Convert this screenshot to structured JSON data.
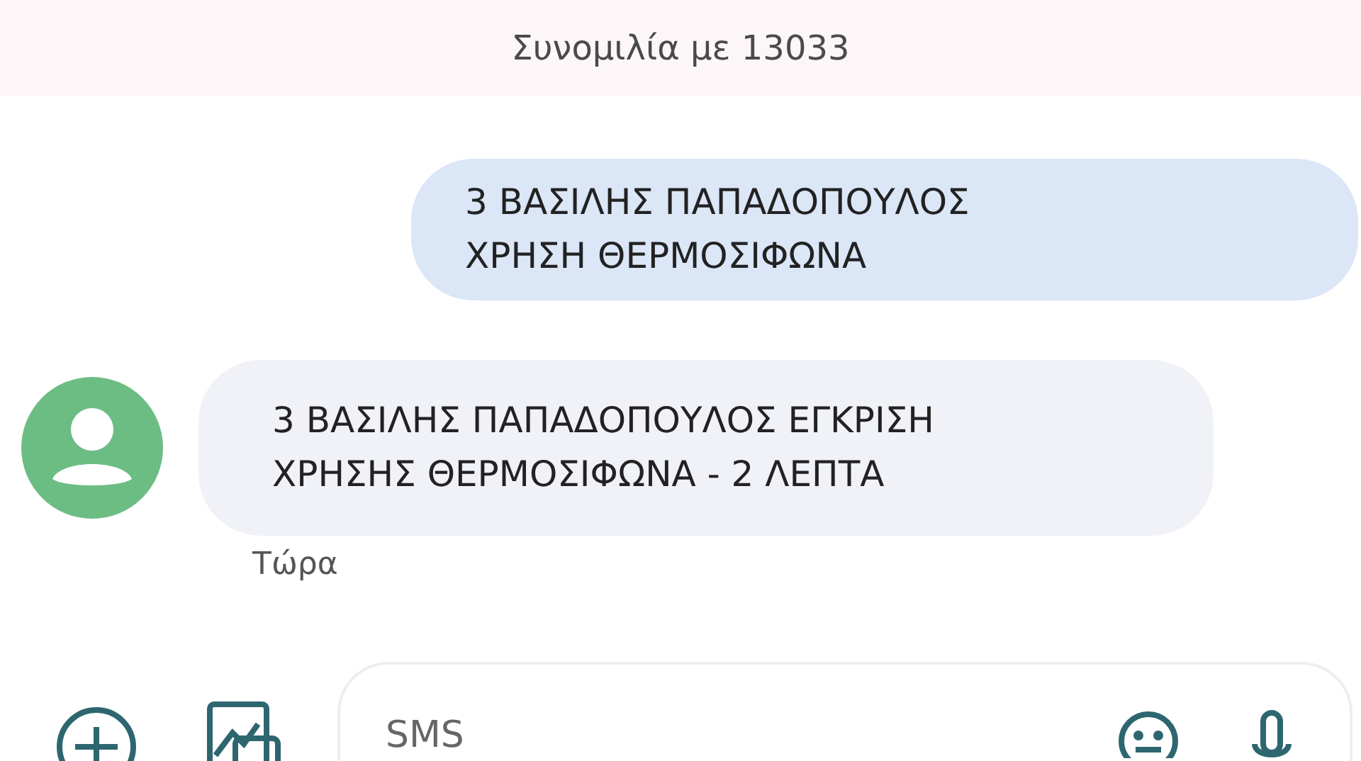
{
  "header": {
    "title": "Συνομιλία με 13033"
  },
  "messages": [
    {
      "kind": "sent",
      "text": "3 ΒΑΣΙΛΗΣ ΠΑΠΑΔΟΠΟΥΛΟΣ\nΧΡΗΣΗ ΘΕΡΜΟΣΙΦΩΝΑ"
    },
    {
      "kind": "received",
      "text": "3 ΒΑΣΙΛΗΣ ΠΑΠΑΔΟΠΟΥΛΟΣ ΕΓΚΡΙΣΗ\nΧΡΗΣΗΣ ΘΕΡΜΟΣΙΦΩΝΑ - 2 ΛΕΠΤΑ",
      "time": "Τώρα"
    }
  ],
  "composer": {
    "placeholder": "SMS"
  }
}
